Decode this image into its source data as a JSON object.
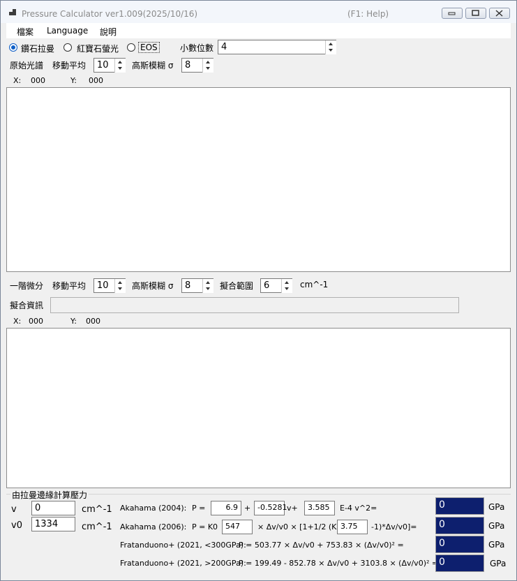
{
  "window": {
    "title": "Pressure Calculator  ver1.009(2025/10/16)",
    "help": "(F1: Help)"
  },
  "menu": {
    "file": "檔案",
    "language": "Language",
    "help": "說明"
  },
  "mode": {
    "diamond": "鑽石拉曼",
    "ruby": "紅寶石螢光",
    "eos": "EOS",
    "selected": "diamond",
    "decimals_label": "小數位數",
    "decimals_value": "4"
  },
  "raw": {
    "label": "原始光譜",
    "moving_avg_label": "移動平均",
    "moving_avg_value": "10",
    "gauss_label": "高斯模糊 σ",
    "gauss_value": "8",
    "x_label": "X:",
    "x_value": "000",
    "y_label": "Y:",
    "y_value": "000"
  },
  "deriv": {
    "label": "一階微分",
    "moving_avg_label": "移動平均",
    "moving_avg_value": "10",
    "gauss_label": "高斯模糊 σ",
    "gauss_value": "8",
    "fit_range_label": "擬合範圍",
    "fit_range_value": "6",
    "fit_unit": "cm^-1",
    "fit_info_label": "擬合資訊",
    "fit_info_value": "",
    "x_label": "X:",
    "x_value": "000",
    "y_label": "Y:",
    "y_value": "000"
  },
  "calc": {
    "group_title": "由拉曼邊緣計算壓力",
    "v_label": "v",
    "v_value": "0",
    "v_unit": "cm^-1",
    "v0_label": "v0",
    "v0_value": "1334",
    "v0_unit": "cm^-1",
    "akahama2004": {
      "name": "Akahama (2004):",
      "p_eq": "P =",
      "a": "6.9",
      "plus1": "+",
      "b": "-0.5281",
      "v_plus": "v+",
      "c": "3.585",
      "tail": "E-4 v^2=",
      "result": "0",
      "unit": "GPa"
    },
    "akahama2006": {
      "name": "Akahama (2006):",
      "p_eq": "P = K0",
      "k0": "547",
      "mid": "× Δv/v0 × [1+1/2 (K0'",
      "k0p": "3.75",
      "tail": "-1)*Δv/v0]=",
      "result": "0",
      "unit": "GPa"
    },
    "frat_low": {
      "name": "Fratanduono+ (2021, <300GPa):",
      "formula": "P = 503.77 × Δv/v0 + 753.83 × (Δv/v0)² =",
      "result": "0",
      "unit": "GPa"
    },
    "frat_high": {
      "name": "Fratanduono+ (2021, >200GPa):",
      "formula": "P = 199.49 - 852.78 × Δv/v0 + 3103.8 × (Δv/v0)² =",
      "result": "0",
      "unit": "GPa"
    }
  }
}
